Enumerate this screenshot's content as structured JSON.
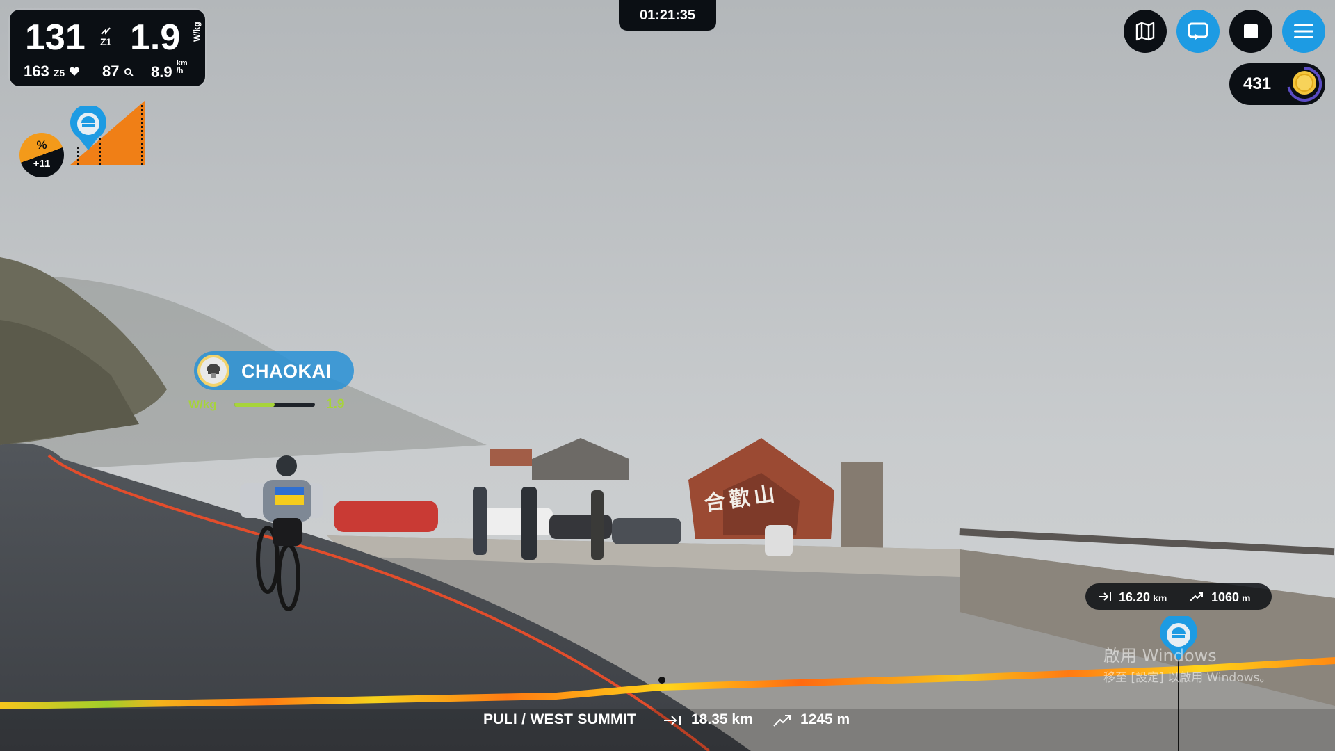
{
  "metrics": {
    "power": "131",
    "power_zone": "Z1",
    "wkg": "1.9",
    "wkg_unit": "W/kg",
    "heart_rate": "163",
    "hr_zone": "Z5",
    "cadence": "87",
    "speed": "8.9",
    "speed_unit_top": "km",
    "speed_unit_bottom": "/h"
  },
  "gradient": {
    "symbol": "%",
    "value": "+11"
  },
  "timer": "01:21:35",
  "toolbar": {
    "map_icon": "map-icon",
    "replay_icon": "replay-icon",
    "stop_icon": "stop-icon",
    "menu_icon": "menu-icon"
  },
  "coins": {
    "count": "431",
    "icon": "coin-icon"
  },
  "rider": {
    "name": "CHAOKAI",
    "wkg_label": "W/kg",
    "wkg_value": "1.9",
    "wkg_fraction": 0.5
  },
  "remaining": {
    "distance": "16.20",
    "distance_unit": "km",
    "elevation": "1060",
    "elevation_unit": "m"
  },
  "route": {
    "name": "PULI / WEST SUMMIT",
    "distance": "18.35 km",
    "elevation": "1245 m"
  },
  "watermark": {
    "line1": "啟用 Windows",
    "line2": "移至 [設定] 以啟用 Windows。"
  },
  "sign_text": "合歡山",
  "colors": {
    "accent_blue": "#1d9be3",
    "grade_orange": "#f39a1a",
    "wkg_green": "#a7d43a",
    "panel_dark": "#0b0f14"
  }
}
